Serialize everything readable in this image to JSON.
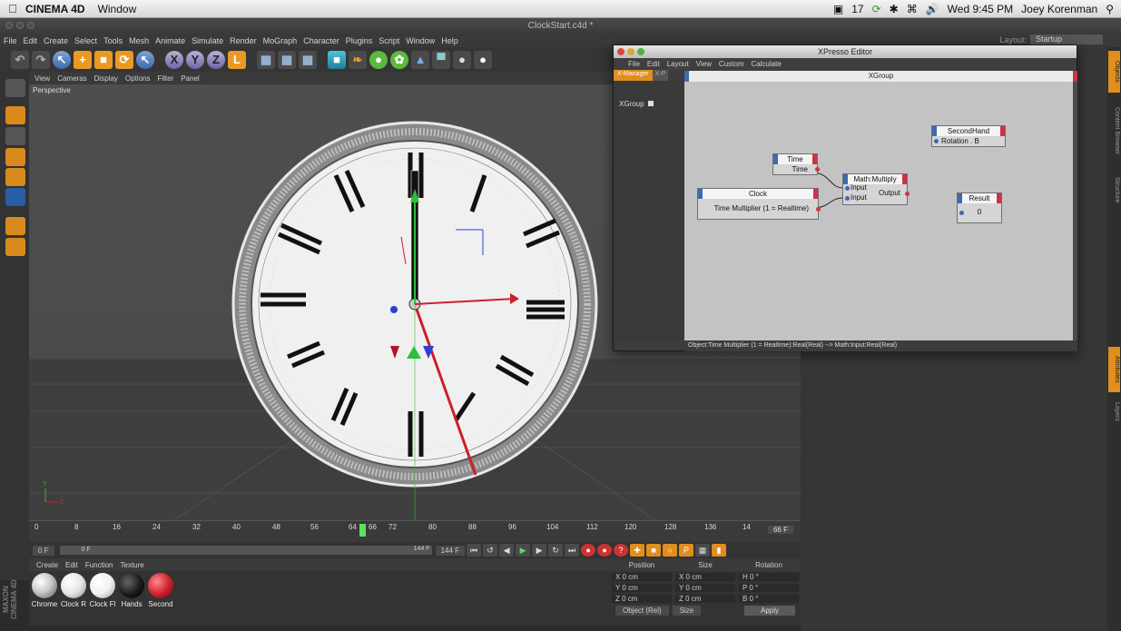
{
  "mac_menubar": {
    "app_name": "CINEMA 4D",
    "items": [
      "Window"
    ],
    "status_notif": "17",
    "clock": "Wed 9:45 PM",
    "user": "Joey Korenman"
  },
  "window": {
    "title": "ClockStart.c4d *"
  },
  "menu": {
    "items": [
      "File",
      "Edit",
      "Create",
      "Select",
      "Tools",
      "Mesh",
      "Animate",
      "Simulate",
      "Render",
      "MoGraph",
      "Character",
      "Plugins",
      "Script",
      "Window",
      "Help"
    ],
    "layout_label": "Layout:",
    "layout_value": "Startup"
  },
  "viewport": {
    "menu": [
      "View",
      "Cameras",
      "Display",
      "Options",
      "Filter",
      "Panel"
    ],
    "camera_label": "Perspective",
    "numerals": [
      "XII",
      "I",
      "II",
      "III",
      "IIII",
      "V",
      "VI",
      "VII",
      "VIII",
      "IX",
      "X",
      "XI"
    ],
    "axis_y": "Y",
    "axis_z": "Z"
  },
  "timeline": {
    "ticks": [
      "0",
      "8",
      "16",
      "24",
      "32",
      "40",
      "48",
      "56",
      "64",
      "66",
      "72",
      "80",
      "88",
      "96",
      "104",
      "112",
      "120",
      "128",
      "136",
      "14"
    ],
    "current_frame": "66 F",
    "start_field": "0 F",
    "min_field": "0 F",
    "max_field": "144 F",
    "end_field": "144 F"
  },
  "materials": {
    "menu": [
      "Create",
      "Edit",
      "Function",
      "Texture"
    ],
    "items": [
      {
        "name": "Chrome",
        "color": "#c9c9c9"
      },
      {
        "name": "Clock R",
        "color": "#e6e6e6"
      },
      {
        "name": "Clock Fl",
        "color": "#f2f2f2"
      },
      {
        "name": "Hands",
        "color": "#1a1a1a"
      },
      {
        "name": "Second",
        "color": "#cc1f2b"
      }
    ],
    "brand": "MAXON CINEMA 4D"
  },
  "coords": {
    "headers": [
      "Position",
      "Size",
      "Rotation"
    ],
    "rows": [
      {
        "pos": "X  0 cm",
        "size": "X  0 cm",
        "rot": "H  0 °"
      },
      {
        "pos": "Y  0 cm",
        "size": "Y  0 cm",
        "rot": "P  0 °"
      },
      {
        "pos": "Z  0 cm",
        "size": "Z  0 cm",
        "rot": "B  0 °"
      }
    ],
    "mode": "Object (Rel)",
    "size_mode": "Size",
    "apply": "Apply"
  },
  "right_tabs": [
    "Objects",
    "Content Browser",
    "Structure",
    "Attributes",
    "Layers"
  ],
  "xpresso": {
    "title": "XPresso Editor",
    "menu": [
      "File",
      "Edit",
      "Layout",
      "View",
      "Custom",
      "Calculate"
    ],
    "tabs": [
      "X-Manager",
      "X-P"
    ],
    "tree_item": "XGroup",
    "graph_title": "XGroup",
    "status": "Object:Time Multiplier (1 = Realtime):Real(Real) --> Math:Input:Real(Real)",
    "nodes": {
      "time": {
        "title": "Time",
        "port": "Time"
      },
      "clock": {
        "title": "Clock",
        "port": "Time Multiplier (1 = Realtime)"
      },
      "math": {
        "title": "Math:Multiply",
        "in1": "Input",
        "in2": "Input",
        "out": "Output"
      },
      "second": {
        "title": "SecondHand",
        "port": "Rotation . B"
      },
      "result": {
        "title": "Result",
        "value": "0"
      }
    }
  },
  "colors": {
    "accent": "#e08e1d",
    "port_in": "#3c6bb0",
    "port_out": "#cc3344"
  }
}
